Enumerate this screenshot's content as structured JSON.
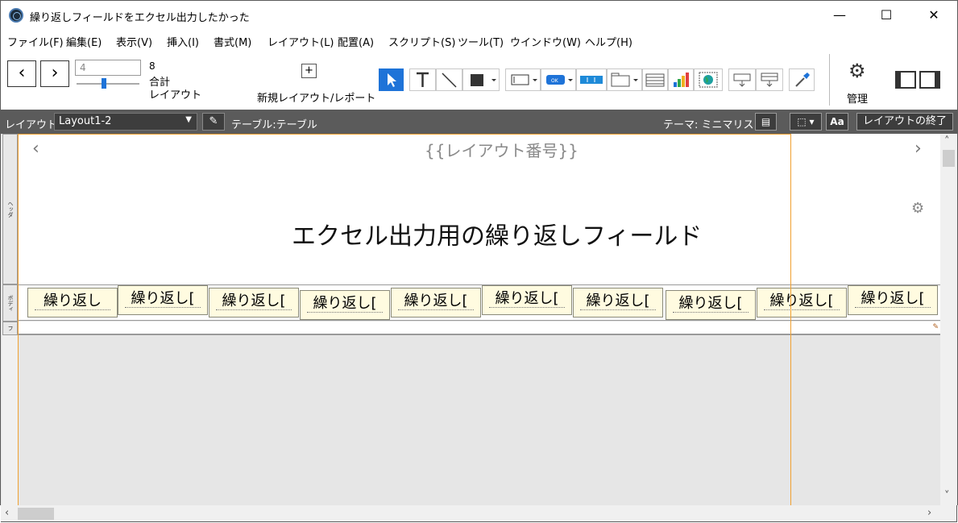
{
  "window": {
    "title": "繰り返しフィールドをエクセル出力したかった",
    "minimize": "—",
    "maximize": "☐",
    "close": "✕"
  },
  "menu": [
    "ファイル(F)",
    "編集(E)",
    "表示(V)",
    "挿入(I)",
    "書式(M)",
    "レイアウト(L)",
    "配置(A)",
    "スクリプト(S)",
    "ツール(T)",
    "ウインドウ(W)",
    "ヘルプ(H)"
  ],
  "toolbar": {
    "prev_icon": "chevron-left-icon",
    "next_icon": "chevron-right-icon",
    "record_value": "4",
    "slider_level": 0.45,
    "record_count": "8",
    "total_label": "合計",
    "layout_label": "レイアウト",
    "new_layout_label": "新規レイアウト/レポート",
    "manage_label": "管理",
    "accent_color": "#1e73d8"
  },
  "statusbar": {
    "layout_label": "レイアウト:",
    "layout_value": "Layout1-2",
    "table_label": "テーブル:テーブル",
    "theme_label": "テーマ: ミニマリスト",
    "aa_label": "Aa",
    "exit_label": "レイアウトの終了"
  },
  "canvas": {
    "layout_number": "{{レイアウト番号}}",
    "title": "エクセル出力用の繰り返しフィールド",
    "parts": {
      "header": "ヘッダ",
      "body": "ボディ",
      "footer": "フ"
    },
    "repeating_fields": [
      "繰り返し",
      "繰り返し[",
      "繰り返し[",
      "繰り返し[",
      "繰り返し[",
      "繰り返し[",
      "繰り返し[",
      "繰り返し[",
      "繰り返し[",
      "繰り返し["
    ]
  }
}
